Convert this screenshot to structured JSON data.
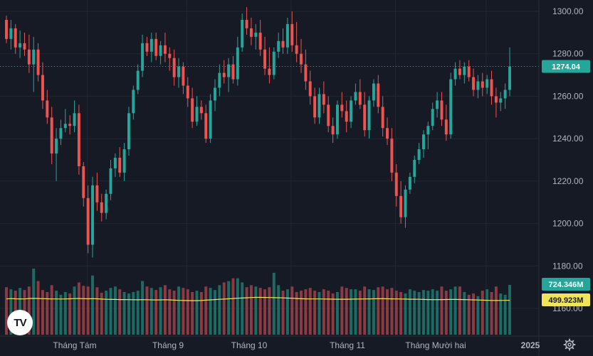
{
  "chart_data": {
    "type": "candlestick",
    "price_axis": {
      "ylim": [
        1152,
        1304
      ],
      "ticks": [
        1300,
        1280,
        1260,
        1240,
        1220,
        1200,
        1180,
        1160
      ]
    },
    "time_axis": {
      "labels": [
        "Tháng Tám",
        "Tháng 9",
        "Tháng 10",
        "Tháng 11",
        "Tháng Mười hai",
        "2025"
      ]
    },
    "last_price": {
      "value": 1274.04,
      "label": "1274.04"
    },
    "volume": {
      "label": "724.346M",
      "ma_label": "499.923M",
      "scale_max_m": 1250
    },
    "colors": {
      "up": "#26a69a",
      "down": "#ef5350",
      "up_vol": "#1e6b64",
      "down_vol": "#8c3b43",
      "ma": "#f0e45a",
      "bg": "#161a25",
      "grid": "#232734"
    },
    "candles": [
      [
        1296,
        1298,
        1285,
        1287
      ],
      [
        1287,
        1296,
        1282,
        1292
      ],
      [
        1292,
        1294,
        1280,
        1283
      ],
      [
        1283,
        1291,
        1278,
        1285
      ],
      [
        1285,
        1290,
        1279,
        1282
      ],
      [
        1282,
        1289,
        1271,
        1275
      ],
      [
        1275,
        1288,
        1262,
        1282
      ],
      [
        1282,
        1285,
        1267,
        1270
      ],
      [
        1270,
        1276,
        1254,
        1258
      ],
      [
        1258,
        1263,
        1247,
        1250
      ],
      [
        1250,
        1255,
        1228,
        1233
      ],
      [
        1233,
        1245,
        1220,
        1240
      ],
      [
        1240,
        1249,
        1237,
        1245
      ],
      [
        1245,
        1254,
        1243,
        1247
      ],
      [
        1247,
        1251,
        1242,
        1246
      ],
      [
        1246,
        1258,
        1243,
        1252
      ],
      [
        1252,
        1256,
        1223,
        1227
      ],
      [
        1227,
        1229,
        1208,
        1212
      ],
      [
        1212,
        1218,
        1186,
        1190
      ],
      [
        1190,
        1222,
        1184,
        1218
      ],
      [
        1218,
        1224,
        1206,
        1210
      ],
      [
        1210,
        1214,
        1201,
        1205
      ],
      [
        1205,
        1216,
        1202,
        1214
      ],
      [
        1214,
        1230,
        1211,
        1226
      ],
      [
        1226,
        1233,
        1222,
        1231
      ],
      [
        1231,
        1236,
        1222,
        1224
      ],
      [
        1224,
        1238,
        1220,
        1235
      ],
      [
        1235,
        1255,
        1232,
        1252
      ],
      [
        1252,
        1265,
        1249,
        1263
      ],
      [
        1263,
        1275,
        1261,
        1272
      ],
      [
        1272,
        1289,
        1269,
        1285
      ],
      [
        1285,
        1288,
        1279,
        1281
      ],
      [
        1281,
        1290,
        1276,
        1287
      ],
      [
        1287,
        1290,
        1277,
        1279
      ],
      [
        1279,
        1286,
        1275,
        1284
      ],
      [
        1284,
        1290,
        1276,
        1280
      ],
      [
        1280,
        1283,
        1272,
        1278
      ],
      [
        1278,
        1282,
        1265,
        1269
      ],
      [
        1269,
        1278,
        1264,
        1274
      ],
      [
        1274,
        1276,
        1261,
        1265
      ],
      [
        1265,
        1269,
        1255,
        1259
      ],
      [
        1259,
        1264,
        1245,
        1248
      ],
      [
        1248,
        1260,
        1246,
        1255
      ],
      [
        1255,
        1258,
        1249,
        1252
      ],
      [
        1252,
        1256,
        1238,
        1240
      ],
      [
        1240,
        1261,
        1238,
        1258
      ],
      [
        1258,
        1268,
        1253,
        1264
      ],
      [
        1264,
        1275,
        1260,
        1271
      ],
      [
        1271,
        1277,
        1266,
        1269
      ],
      [
        1269,
        1278,
        1262,
        1275
      ],
      [
        1275,
        1279,
        1266,
        1268
      ],
      [
        1268,
        1288,
        1265,
        1283
      ],
      [
        1283,
        1299,
        1281,
        1296
      ],
      [
        1296,
        1302,
        1289,
        1292
      ],
      [
        1292,
        1297,
        1284,
        1288
      ],
      [
        1288,
        1294,
        1282,
        1290
      ],
      [
        1290,
        1296,
        1279,
        1282
      ],
      [
        1282,
        1288,
        1270,
        1273
      ],
      [
        1273,
        1283,
        1266,
        1270
      ],
      [
        1270,
        1283,
        1268,
        1281
      ],
      [
        1281,
        1290,
        1278,
        1286
      ],
      [
        1286,
        1292,
        1280,
        1283
      ],
      [
        1283,
        1297,
        1280,
        1294
      ],
      [
        1294,
        1300,
        1281,
        1284
      ],
      [
        1284,
        1295,
        1276,
        1280
      ],
      [
        1280,
        1287,
        1271,
        1275
      ],
      [
        1275,
        1282,
        1263,
        1267
      ],
      [
        1267,
        1272,
        1256,
        1260
      ],
      [
        1260,
        1264,
        1247,
        1250
      ],
      [
        1250,
        1264,
        1247,
        1261
      ],
      [
        1261,
        1267,
        1252,
        1256
      ],
      [
        1256,
        1260,
        1243,
        1246
      ],
      [
        1246,
        1250,
        1238,
        1242
      ],
      [
        1242,
        1258,
        1240,
        1256
      ],
      [
        1256,
        1262,
        1250,
        1253
      ],
      [
        1253,
        1258,
        1243,
        1248
      ],
      [
        1248,
        1260,
        1245,
        1258
      ],
      [
        1258,
        1266,
        1256,
        1262
      ],
      [
        1262,
        1268,
        1254,
        1256
      ],
      [
        1256,
        1262,
        1241,
        1244
      ],
      [
        1244,
        1260,
        1240,
        1258
      ],
      [
        1258,
        1268,
        1255,
        1266
      ],
      [
        1266,
        1270,
        1252,
        1255
      ],
      [
        1255,
        1260,
        1241,
        1245
      ],
      [
        1245,
        1250,
        1237,
        1240
      ],
      [
        1240,
        1245,
        1220,
        1224
      ],
      [
        1224,
        1228,
        1208,
        1213
      ],
      [
        1213,
        1220,
        1200,
        1203
      ],
      [
        1203,
        1218,
        1198,
        1216
      ],
      [
        1216,
        1224,
        1214,
        1222
      ],
      [
        1222,
        1232,
        1219,
        1230
      ],
      [
        1230,
        1238,
        1228,
        1235
      ],
      [
        1235,
        1244,
        1231,
        1242
      ],
      [
        1242,
        1248,
        1235,
        1246
      ],
      [
        1246,
        1257,
        1244,
        1254
      ],
      [
        1254,
        1262,
        1250,
        1258
      ],
      [
        1258,
        1262,
        1246,
        1249
      ],
      [
        1249,
        1256,
        1239,
        1242
      ],
      [
        1242,
        1271,
        1240,
        1268
      ],
      [
        1268,
        1276,
        1265,
        1273
      ],
      [
        1273,
        1277,
        1268,
        1270
      ],
      [
        1270,
        1276,
        1266,
        1274
      ],
      [
        1274,
        1277,
        1267,
        1269
      ],
      [
        1269,
        1273,
        1260,
        1263
      ],
      [
        1263,
        1270,
        1259,
        1267
      ],
      [
        1267,
        1271,
        1260,
        1264
      ],
      [
        1264,
        1270,
        1261,
        1268
      ],
      [
        1268,
        1272,
        1256,
        1260
      ],
      [
        1260,
        1264,
        1250,
        1257
      ],
      [
        1257,
        1262,
        1253,
        1259
      ],
      [
        1259,
        1266,
        1254,
        1263
      ],
      [
        1263,
        1283,
        1260,
        1274.04
      ]
    ],
    "volumes": [
      690,
      660,
      640,
      680,
      650,
      700,
      960,
      780,
      650,
      620,
      720,
      640,
      580,
      620,
      600,
      700,
      760,
      710,
      700,
      860,
      690,
      610,
      640,
      680,
      700,
      660,
      620,
      600,
      620,
      640,
      780,
      700,
      680,
      650,
      690,
      720,
      660,
      640,
      700,
      680,
      660,
      620,
      640,
      620,
      700,
      680,
      650,
      720,
      760,
      780,
      820,
      820,
      760,
      690,
      720,
      700,
      680,
      660,
      690,
      900,
      720,
      640,
      660,
      700,
      620,
      640,
      660,
      680,
      640,
      620,
      660,
      640,
      600,
      620,
      700,
      680,
      660,
      660,
      640,
      700,
      660,
      650,
      690,
      700,
      660,
      680,
      640,
      620,
      600,
      660,
      640,
      620,
      650,
      640,
      660,
      640,
      700,
      640,
      660,
      700,
      700,
      620,
      580,
      600,
      560,
      640,
      660,
      620,
      700,
      600,
      580,
      724
    ],
    "volume_ma": [
      520,
      525,
      522,
      521,
      520,
      526,
      528,
      526,
      524,
      522,
      520,
      520,
      519,
      520,
      522,
      525,
      526,
      524,
      522,
      524,
      522,
      518,
      514,
      512,
      512,
      510,
      510,
      509,
      508,
      507,
      509,
      508,
      506,
      505,
      506,
      508,
      506,
      502,
      499,
      497,
      496,
      495,
      495,
      497,
      502,
      506,
      510,
      514,
      518,
      522,
      526,
      530,
      533,
      536,
      540,
      542,
      542,
      541,
      540,
      538,
      537,
      535,
      532,
      530,
      526,
      523,
      521,
      520,
      520,
      520,
      519,
      518,
      517,
      516,
      516,
      516,
      517,
      518,
      519,
      520,
      521,
      522,
      523,
      523,
      522,
      521,
      520,
      519,
      518,
      516,
      515,
      514,
      512,
      510,
      509,
      509,
      510,
      511,
      512,
      512,
      511,
      510,
      508,
      506,
      504,
      502,
      500,
      498,
      497,
      498,
      499,
      500
    ]
  }
}
